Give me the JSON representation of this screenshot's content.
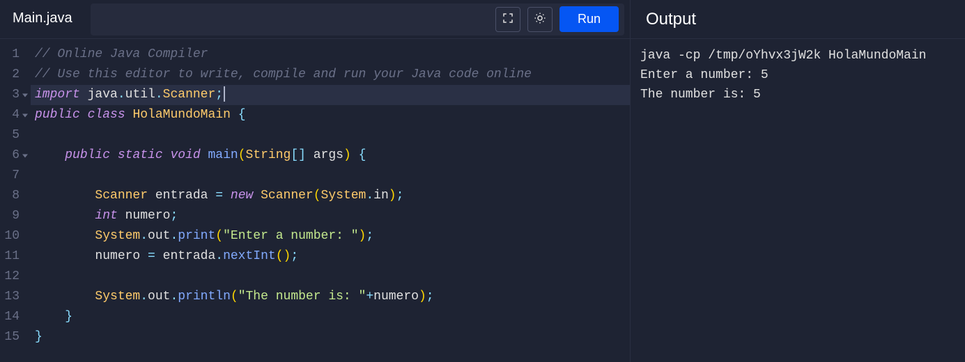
{
  "file_tab": "Main.java",
  "toolbar": {
    "fullscreen_icon": "fullscreen",
    "theme_icon": "sun",
    "run_label": "Run"
  },
  "output_title": "Output",
  "code": {
    "highlighted_line": 3,
    "lines": [
      {
        "n": 1,
        "fold": false,
        "tokens": [
          [
            "comment",
            "// Online Java Compiler"
          ]
        ]
      },
      {
        "n": 2,
        "fold": false,
        "tokens": [
          [
            "comment",
            "// Use this editor to write, compile and run your Java code online"
          ]
        ]
      },
      {
        "n": 3,
        "fold": true,
        "tokens": [
          [
            "keyword",
            "import"
          ],
          [
            "ident",
            " java"
          ],
          [
            "punc",
            "."
          ],
          [
            "ident",
            "util"
          ],
          [
            "punc",
            "."
          ],
          [
            "class",
            "Scanner"
          ],
          [
            "punc",
            ";"
          ]
        ],
        "cursor_after": true
      },
      {
        "n": 4,
        "fold": true,
        "tokens": [
          [
            "keyword",
            "public"
          ],
          [
            "ident",
            " "
          ],
          [
            "keyword",
            "class"
          ],
          [
            "ident",
            " "
          ],
          [
            "class",
            "HolaMundoMain"
          ],
          [
            "ident",
            " "
          ],
          [
            "punc",
            "{"
          ]
        ]
      },
      {
        "n": 5,
        "fold": false,
        "tokens": []
      },
      {
        "n": 6,
        "fold": true,
        "tokens": [
          [
            "ident",
            "    "
          ],
          [
            "keyword",
            "public"
          ],
          [
            "ident",
            " "
          ],
          [
            "keyword",
            "static"
          ],
          [
            "ident",
            " "
          ],
          [
            "type",
            "void"
          ],
          [
            "ident",
            " "
          ],
          [
            "method",
            "main"
          ],
          [
            "paren",
            "("
          ],
          [
            "class",
            "String"
          ],
          [
            "punc",
            "[]"
          ],
          [
            "ident",
            " args"
          ],
          [
            "paren",
            ")"
          ],
          [
            "ident",
            " "
          ],
          [
            "punc",
            "{"
          ]
        ]
      },
      {
        "n": 7,
        "fold": false,
        "tokens": []
      },
      {
        "n": 8,
        "fold": false,
        "tokens": [
          [
            "ident",
            "        "
          ],
          [
            "class",
            "Scanner"
          ],
          [
            "ident",
            " entrada "
          ],
          [
            "op",
            "="
          ],
          [
            "ident",
            " "
          ],
          [
            "keyword",
            "new"
          ],
          [
            "ident",
            " "
          ],
          [
            "class",
            "Scanner"
          ],
          [
            "paren",
            "("
          ],
          [
            "class",
            "System"
          ],
          [
            "punc",
            "."
          ],
          [
            "ident",
            "in"
          ],
          [
            "paren",
            ")"
          ],
          [
            "punc",
            ";"
          ]
        ]
      },
      {
        "n": 9,
        "fold": false,
        "tokens": [
          [
            "ident",
            "        "
          ],
          [
            "type",
            "int"
          ],
          [
            "ident",
            " numero"
          ],
          [
            "punc",
            ";"
          ]
        ]
      },
      {
        "n": 10,
        "fold": false,
        "tokens": [
          [
            "ident",
            "        "
          ],
          [
            "class",
            "System"
          ],
          [
            "punc",
            "."
          ],
          [
            "ident",
            "out"
          ],
          [
            "punc",
            "."
          ],
          [
            "method",
            "print"
          ],
          [
            "paren",
            "("
          ],
          [
            "string",
            "\"Enter a number: \""
          ],
          [
            "paren",
            ")"
          ],
          [
            "punc",
            ";"
          ]
        ]
      },
      {
        "n": 11,
        "fold": false,
        "tokens": [
          [
            "ident",
            "        numero "
          ],
          [
            "op",
            "="
          ],
          [
            "ident",
            " entrada"
          ],
          [
            "punc",
            "."
          ],
          [
            "method",
            "nextInt"
          ],
          [
            "paren",
            "()"
          ],
          [
            "punc",
            ";"
          ]
        ]
      },
      {
        "n": 12,
        "fold": false,
        "tokens": []
      },
      {
        "n": 13,
        "fold": false,
        "tokens": [
          [
            "ident",
            "        "
          ],
          [
            "class",
            "System"
          ],
          [
            "punc",
            "."
          ],
          [
            "ident",
            "out"
          ],
          [
            "punc",
            "."
          ],
          [
            "method",
            "println"
          ],
          [
            "paren",
            "("
          ],
          [
            "string",
            "\"The number is: \""
          ],
          [
            "op",
            "+"
          ],
          [
            "ident",
            "numero"
          ],
          [
            "paren",
            ")"
          ],
          [
            "punc",
            ";"
          ]
        ]
      },
      {
        "n": 14,
        "fold": false,
        "tokens": [
          [
            "ident",
            "    "
          ],
          [
            "punc",
            "}"
          ]
        ]
      },
      {
        "n": 15,
        "fold": false,
        "tokens": [
          [
            "punc",
            "}"
          ]
        ]
      }
    ]
  },
  "output_lines": [
    "java -cp /tmp/oYhvx3jW2k HolaMundoMain",
    "Enter a number: 5",
    "The number is: 5"
  ]
}
